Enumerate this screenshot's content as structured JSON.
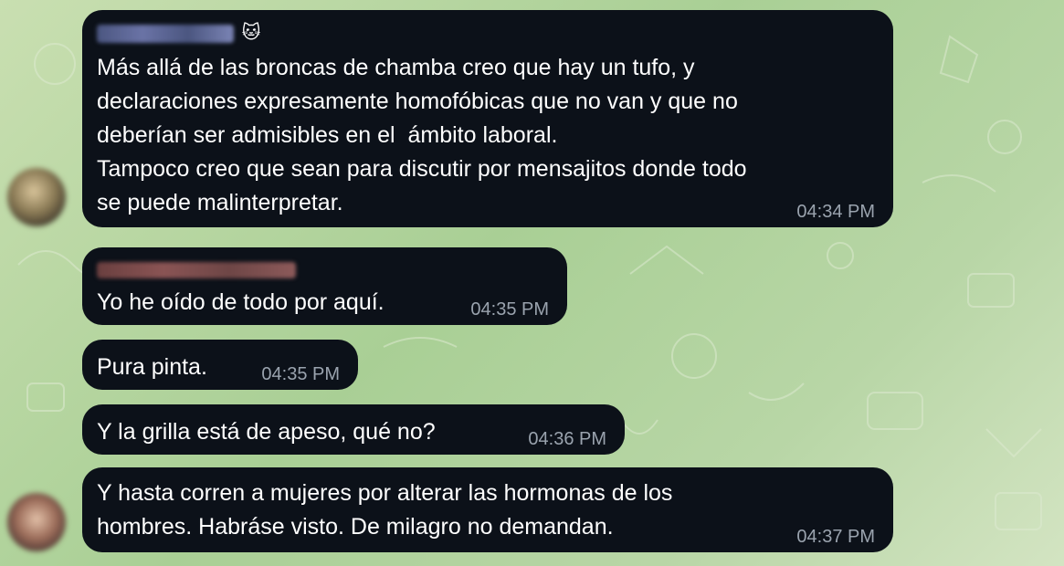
{
  "chat": {
    "messages": [
      {
        "text": "Más allá de las broncas de chamba creo que hay un tufo, y\ndeclaraciones expresamente homofóbicas que no van y que no\ndeberían ser admisibles en el  ámbito laboral.\nTampoco creo que sean para discutir por mensajitos donde todo\nse puede malinterpretar.",
        "time": "04:34 PM",
        "sender_emoji": "🐱"
      },
      {
        "text": "Yo he oído de todo por aquí.",
        "time": "04:35 PM"
      },
      {
        "text": "Pura pinta.",
        "time": "04:35 PM"
      },
      {
        "text": "Y la grilla está de apeso, qué no?",
        "time": "04:36 PM"
      },
      {
        "text": "Y hasta corren a mujeres por alterar las hormonas de los\nhombres. Habráse visto. De milagro no demandan.",
        "time": "04:37 PM"
      }
    ]
  },
  "colors": {
    "bubble": "#0c1119",
    "text": "#ffffff",
    "timestamp": "#9aa3ae",
    "background": "#b3d49f"
  }
}
